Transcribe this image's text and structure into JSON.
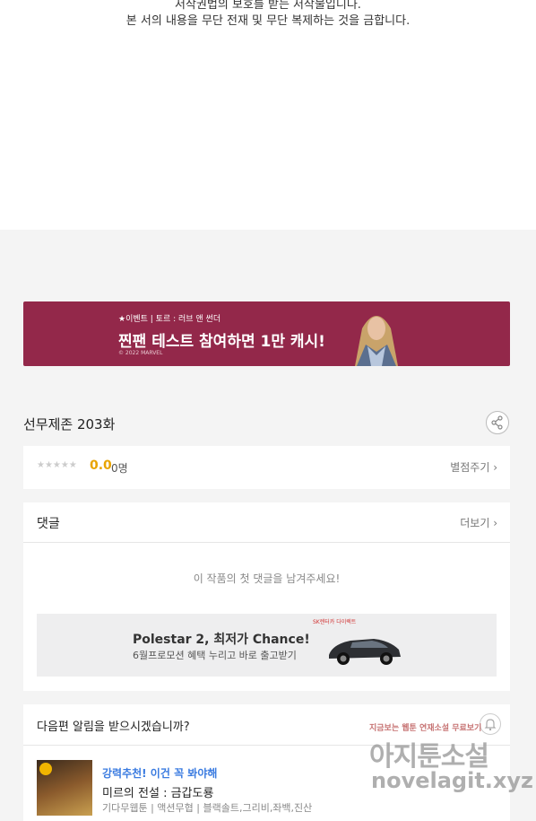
{
  "copyright": {
    "line1": "저작권법의 보호를 받는 저작물입니다.",
    "line2": "본 서의 내용을 무단 전재 및 무단 복제하는 것을 금합니다."
  },
  "banner": {
    "event_label": "★이벤트 | 토르 : 러브 앤 썬더",
    "headline": "찐팬 테스트 참여하면 1만 캐시!",
    "copyright": "© 2022 MARVEL",
    "bg_color": "#93284a"
  },
  "episode": {
    "title": "선무제존 203화",
    "share_icon": "share-icon"
  },
  "rating": {
    "stars": "★★★★★",
    "score": "0.0",
    "count": "0명",
    "rate_link": "별점주기 ›"
  },
  "comments": {
    "header": "댓글",
    "more": "더보기 ›",
    "empty_text": "이 작품의 첫 댓글을 남겨주세요!"
  },
  "ad": {
    "title": "Polestar 2, 최저가 Chance!",
    "subtitle": "6월프로모션 혜택 누리고 바로 출고받기",
    "logo_text": "SK렌터카 다이렉트"
  },
  "notify": {
    "question": "다음편 알림을 받으시겠습니까?",
    "recommend": "강력추천! 이건 꼭 봐야해",
    "title": "미르의 전설 : 금갑도룡",
    "tags": "기다무웹툰 | 액션무협 | 블랙솔트,그리비,좌백,진산"
  },
  "watermark": {
    "line1": "지금보는 웹툰 연재소설 무료보기",
    "line2": "아지툰소설",
    "line3": "novelagit.xyz"
  }
}
